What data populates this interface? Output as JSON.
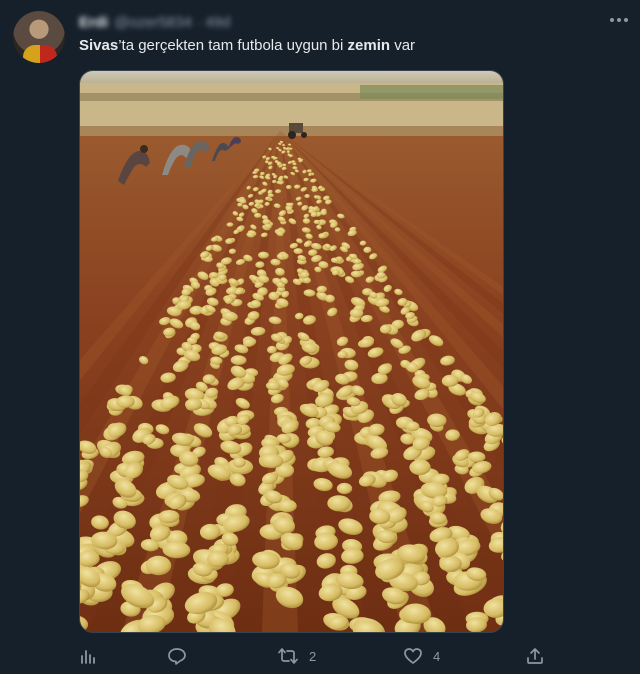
{
  "tweet": {
    "author_name": "Erdi",
    "author_handle": "@ozer5834 · 49d",
    "text_parts": [
      {
        "text": "Sivas",
        "bold": true
      },
      {
        "text": "’ta gerçekten tam futbola uygun bi ",
        "bold": false
      },
      {
        "text": "zemin",
        "bold": true
      },
      {
        "text": " var",
        "bold": false
      }
    ]
  },
  "actions": {
    "analytics_icon": "bar-chart-icon",
    "reply_icon": "speech-bubble-icon",
    "retweet_icon": "retweet-icon",
    "retweet_count": "2",
    "like_icon": "heart-icon",
    "like_count": "4",
    "share_icon": "share-upload-icon"
  },
  "colors": {
    "background": "#15202b",
    "secondary_text": "#8b98a5",
    "soil": "#7a3a18",
    "potato": "#d8c06a"
  }
}
